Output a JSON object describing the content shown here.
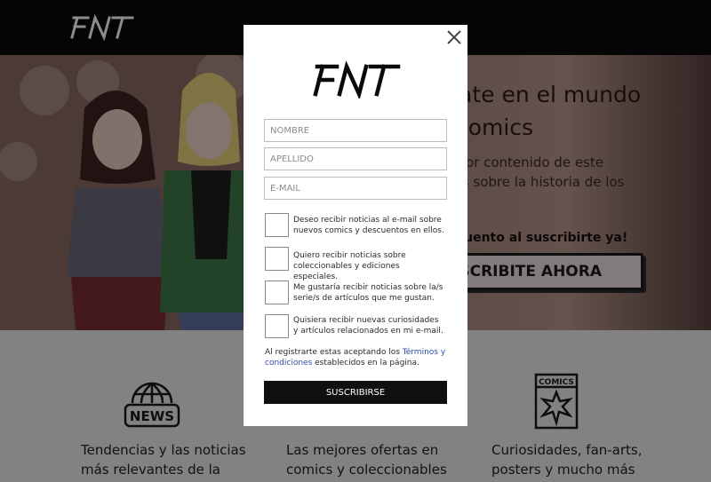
{
  "nav": {
    "logo_text": "FNT"
  },
  "hero": {
    "title": "crate en el mundo\ns comics",
    "text": "mejor contenido de este\nmás sobre la historia de los",
    "promo": "escuento al suscribirte ya!",
    "cta_label": "USCRIBITE AHORA"
  },
  "features": [
    {
      "icon": "globe-news-icon",
      "text": "Tendencias y las noticias\nmás relevantes de la"
    },
    {
      "icon": "offer-icon",
      "text": "Las mejores ofertas en\ncomics y coleccionables"
    },
    {
      "icon": "comics-book-icon",
      "text": "Curiosidades, fan-arts,\nposters y mucho más"
    }
  ],
  "modal": {
    "logo_text": "FNT",
    "fields": [
      {
        "placeholder": "NOMBRE"
      },
      {
        "placeholder": "APELLIDO"
      },
      {
        "placeholder": "E-MAIL"
      }
    ],
    "checkboxes": [
      {
        "label": "Deseo recibir noticias al e-mail sobre nuevos comics y descuentos en ellos."
      },
      {
        "label": "Quiero recibir noticias sobre coleccionables y ediciones especiales."
      },
      {
        "label": "Me gustaría recibir noticias sobre la/s serie/s de artículos que me gustan."
      },
      {
        "label": "Quisiera recibir nuevas curiosidades y artículos relacionados en mi e-mail."
      }
    ],
    "legal_prefix": "Al registrarte estas aceptando los ",
    "legal_link": "Términos y condiciones",
    "legal_suffix": " establecidos en la página.",
    "submit_label": "SUSCRIBIRSE"
  }
}
